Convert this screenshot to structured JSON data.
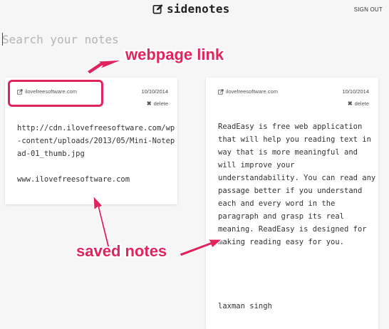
{
  "header": {
    "title": "sidenotes",
    "sign_out": "SIGN OUT"
  },
  "search": {
    "placeholder": "Search your notes",
    "value": ""
  },
  "notes": [
    {
      "link": "ilovefreesoftware.com",
      "date": "10/10/2014",
      "delete_label": "delete",
      "body": "http://cdn.ilovefreesoftware.com/wp-content/uploads/2013/05/Mini-Notepad-01_thumb.jpg\n\nwww.ilovefreesoftware.com"
    },
    {
      "link": "ilovefreesoftware.com",
      "date": "10/10/2014",
      "delete_label": "delete",
      "body": "ReadEasy is free web application that will help you reading text in way that is more meaningful and will improve your understandability. You can read any passage better if you understand each and every word in the paragraph and grasp its real meaning. ReadEasy is designed for making reading easy for you.",
      "author": "laxman singh"
    }
  ],
  "annotations": {
    "webpage_link": "webpage link",
    "saved_notes": "saved notes",
    "color": "#e0245e"
  },
  "icons": {
    "logo": "pencil-edit-icon",
    "link": "external-link-icon",
    "delete": "close-x-icon"
  }
}
